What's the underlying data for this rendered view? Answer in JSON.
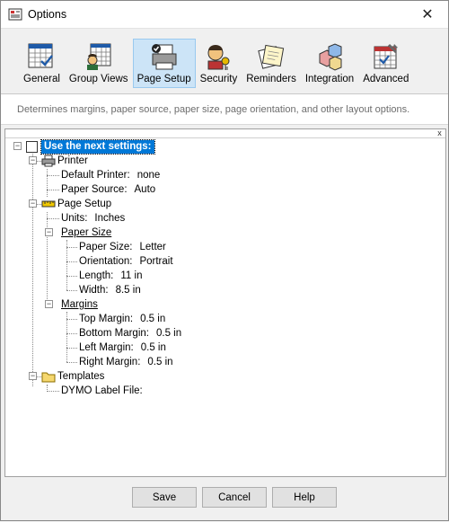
{
  "window": {
    "title": "Options",
    "close_glyph": "✕"
  },
  "toolbar": {
    "items": [
      {
        "label": "General",
        "icon": "calendar-check-icon"
      },
      {
        "label": "Group Views",
        "icon": "calendar-user-icon"
      },
      {
        "label": "Page Setup",
        "icon": "printer-icon",
        "selected": true
      },
      {
        "label": "Security",
        "icon": "user-key-icon"
      },
      {
        "label": "Reminders",
        "icon": "notes-icon"
      },
      {
        "label": "Integration",
        "icon": "blocks-icon"
      },
      {
        "label": "Advanced",
        "icon": "calendar-wrench-icon"
      }
    ]
  },
  "description": "Determines margins, paper source, paper size, page orientation, and other layout options.",
  "panel": {
    "close_glyph": "x"
  },
  "tree": {
    "root": {
      "label": "Use the next settings:",
      "checked": false
    },
    "printer": {
      "label": "Printer",
      "default_printer_label": "Default Printer:",
      "default_printer_value": "none",
      "paper_source_label": "Paper Source:",
      "paper_source_value": "Auto"
    },
    "page_setup": {
      "label": "Page Setup",
      "units_label": "Units:",
      "units_value": "Inches",
      "paper_size": {
        "label": "Paper Size",
        "paper_size_label": "Paper Size:",
        "paper_size_value": "Letter",
        "orientation_label": "Orientation:",
        "orientation_value": "Portrait",
        "length_label": "Length:",
        "length_value": "11 in",
        "width_label": "Width:",
        "width_value": "8.5 in"
      },
      "margins": {
        "label": "Margins",
        "top_label": "Top Margin:",
        "top_value": "0.5 in",
        "bottom_label": "Bottom Margin:",
        "bottom_value": "0.5 in",
        "left_label": "Left Margin:",
        "left_value": "0.5 in",
        "right_label": "Right Margin:",
        "right_value": "0.5 in"
      }
    },
    "templates": {
      "label": "Templates",
      "dymo_label": "DYMO Label File:"
    },
    "collapse_glyph": "−"
  },
  "buttons": {
    "save": "Save",
    "cancel": "Cancel",
    "help": "Help"
  },
  "colors": {
    "selection": "#0078d7",
    "toolbar_active": "#cce4f7"
  }
}
